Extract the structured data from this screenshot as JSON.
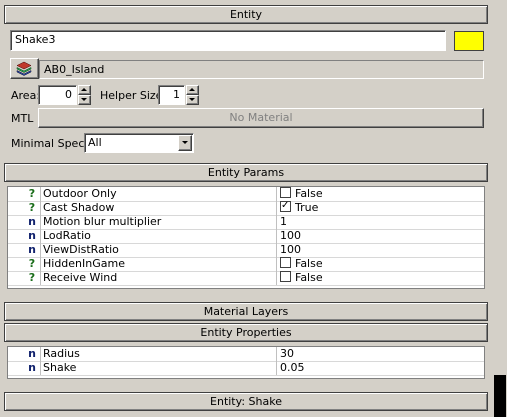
{
  "entity": {
    "header": "Entity",
    "name_value": "Shake3",
    "color_swatch": "#ffff00",
    "layer_value": "AB0_Island",
    "area_label": "Area:",
    "area_value": "0",
    "helper_label": "Helper Size:",
    "helper_value": "1",
    "mtl_label": "MTL",
    "mtl_button": "No Material",
    "minspec_label": "Minimal Spec:",
    "minspec_value": "All"
  },
  "entity_params": {
    "header": "Entity Params",
    "rows": [
      {
        "icon": "?",
        "name": "Outdoor Only",
        "value": "False",
        "checkbox": true,
        "checked": false
      },
      {
        "icon": "?",
        "name": "Cast Shadow",
        "value": "True",
        "checkbox": true,
        "checked": true
      },
      {
        "icon": "n",
        "name": "Motion blur multiplier",
        "value": "1",
        "checkbox": false
      },
      {
        "icon": "n",
        "name": "LodRatio",
        "value": "100",
        "checkbox": false
      },
      {
        "icon": "n",
        "name": "ViewDistRatio",
        "value": "100",
        "checkbox": false
      },
      {
        "icon": "?",
        "name": "HiddenInGame",
        "value": "False",
        "checkbox": true,
        "checked": false
      },
      {
        "icon": "?",
        "name": "Receive Wind",
        "value": "False",
        "checkbox": true,
        "checked": false
      }
    ]
  },
  "material_layers": {
    "header": "Material Layers"
  },
  "entity_properties": {
    "header": "Entity Properties",
    "rows": [
      {
        "icon": "n",
        "name": "Radius",
        "value": "30"
      },
      {
        "icon": "n",
        "name": "Shake",
        "value": "0.05"
      }
    ]
  },
  "entity_shake": {
    "header": "Entity: Shake"
  }
}
